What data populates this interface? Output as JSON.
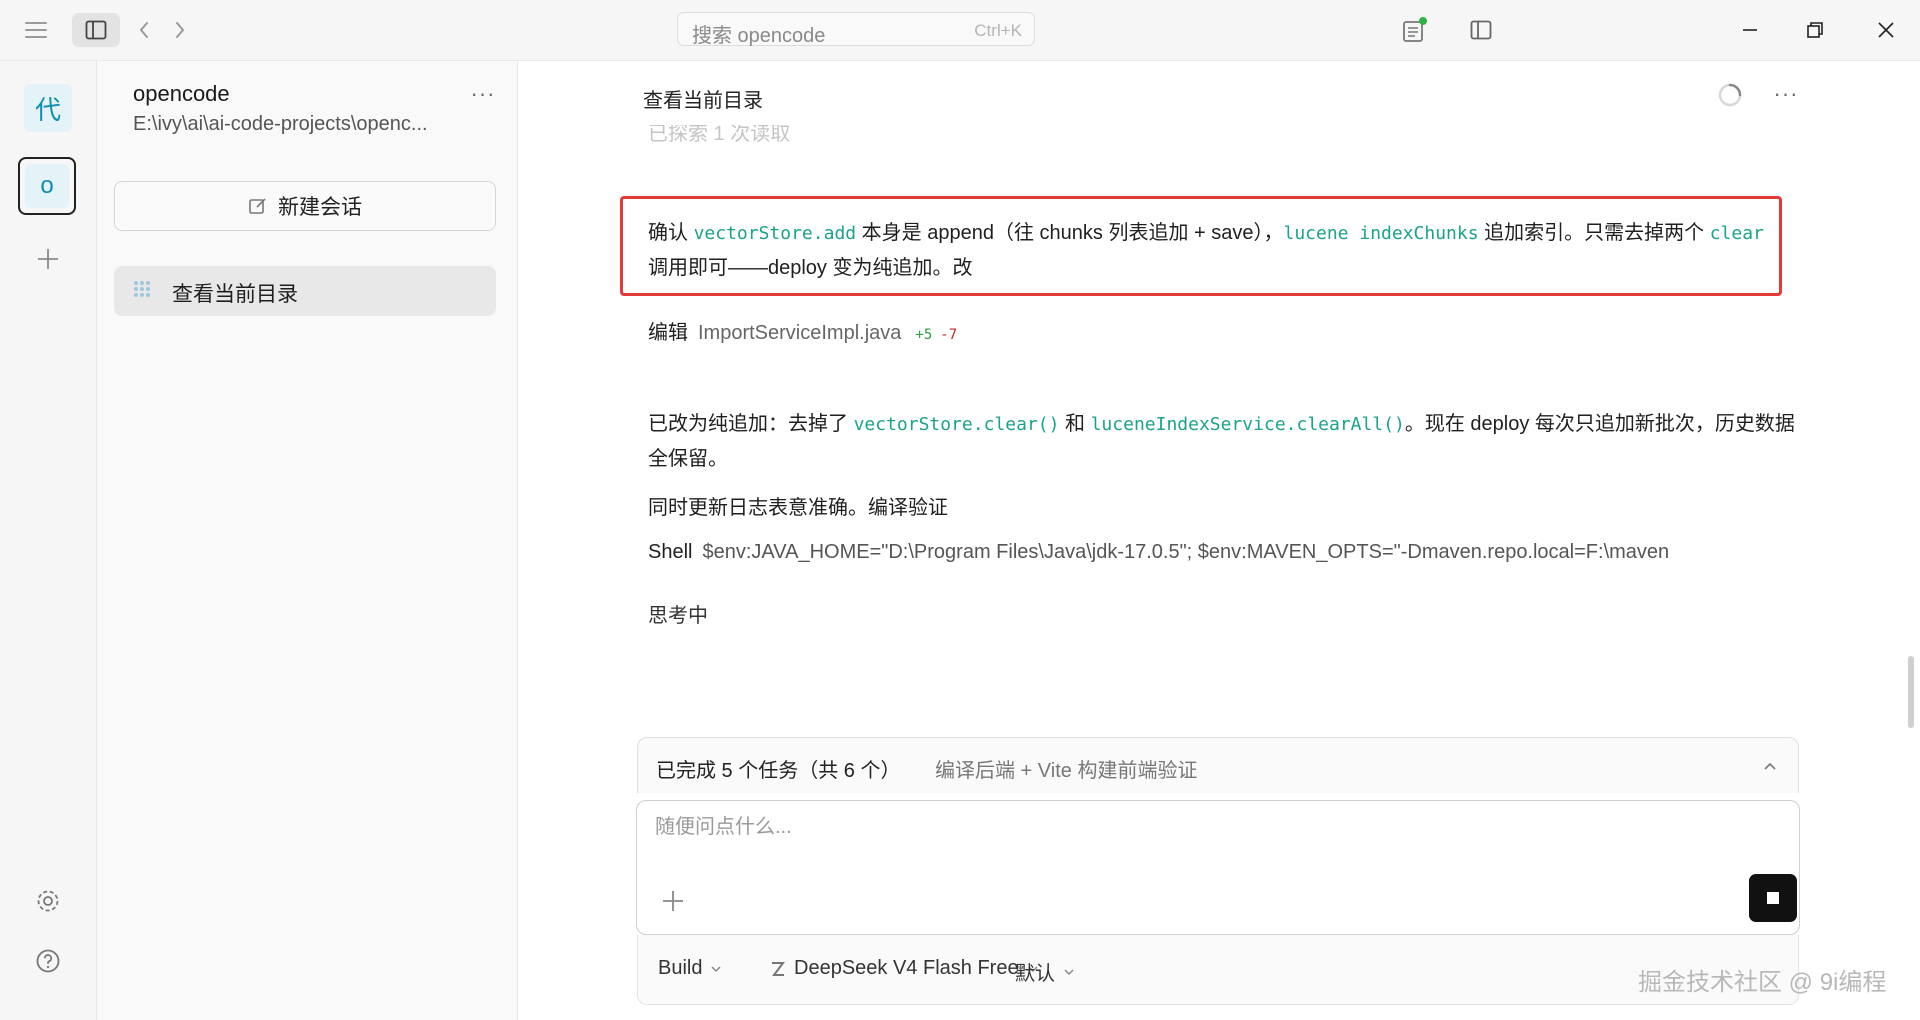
{
  "titlebar": {
    "search_placeholder": "搜索 opencode",
    "search_shortcut": "Ctrl+K"
  },
  "rail": {
    "projects": [
      {
        "label": "代"
      },
      {
        "label": "o"
      }
    ]
  },
  "sidebar": {
    "project_name": "opencode",
    "project_path": "E:\\ivy\\ai\\ai-code-projects\\openc...",
    "more": "···",
    "new_session_label": "新建会话",
    "sessions": [
      {
        "title": "查看当前目录"
      }
    ]
  },
  "main": {
    "title": "查看当前目录",
    "more": "···",
    "faded_line": "已探索 1 次读取",
    "messages": {
      "confirm": {
        "t1": "确认 ",
        "c1": "vectorStore.add",
        "t2": " 本身是 append（往 chunks 列表追加 + save），",
        "c2": "lucene indexChunks",
        "t3": " 追加索引。只需去掉两个 ",
        "c3": "clear",
        "t4": " 调用即可——deploy 变为纯追加。改"
      },
      "edit": {
        "label": "编辑",
        "file": "ImportServiceImpl.java",
        "added": "+5",
        "removed": "-7"
      },
      "changed": {
        "t1": "已改为纯追加：去掉了 ",
        "c1": "vectorStore.clear()",
        "t2": " 和 ",
        "c2": "luceneIndexService.clearAll()",
        "t3": "。现在 deploy 每次只追加新批次，历史数据全保留。"
      },
      "log": "同时更新日志表意准确。编译验证",
      "shell": {
        "label": "Shell",
        "command": "$env:JAVA_HOME=\"D:\\Program Files\\Java\\jdk-17.0.5\"; $env:MAVEN_OPTS=\"-Dmaven.repo.local=F:\\maven"
      },
      "thinking": "思考中"
    },
    "todo": {
      "summary": "已完成 5 个任务（共 6 个）",
      "current": "编译后端 + Vite 构建前端验证"
    },
    "composer": {
      "placeholder": "随便问点什么..."
    },
    "footer": {
      "agent": "Build",
      "model": "DeepSeek V4 Flash Free",
      "variant": "默认"
    }
  },
  "watermark": "掘金技术社区 @ 9i编程",
  "colors": {
    "accent_code": "#1aa38a",
    "highlight_border": "#e53a3a",
    "status_dot": "#2fb344",
    "diff_add": "#2f9e44",
    "diff_del": "#c62828"
  }
}
